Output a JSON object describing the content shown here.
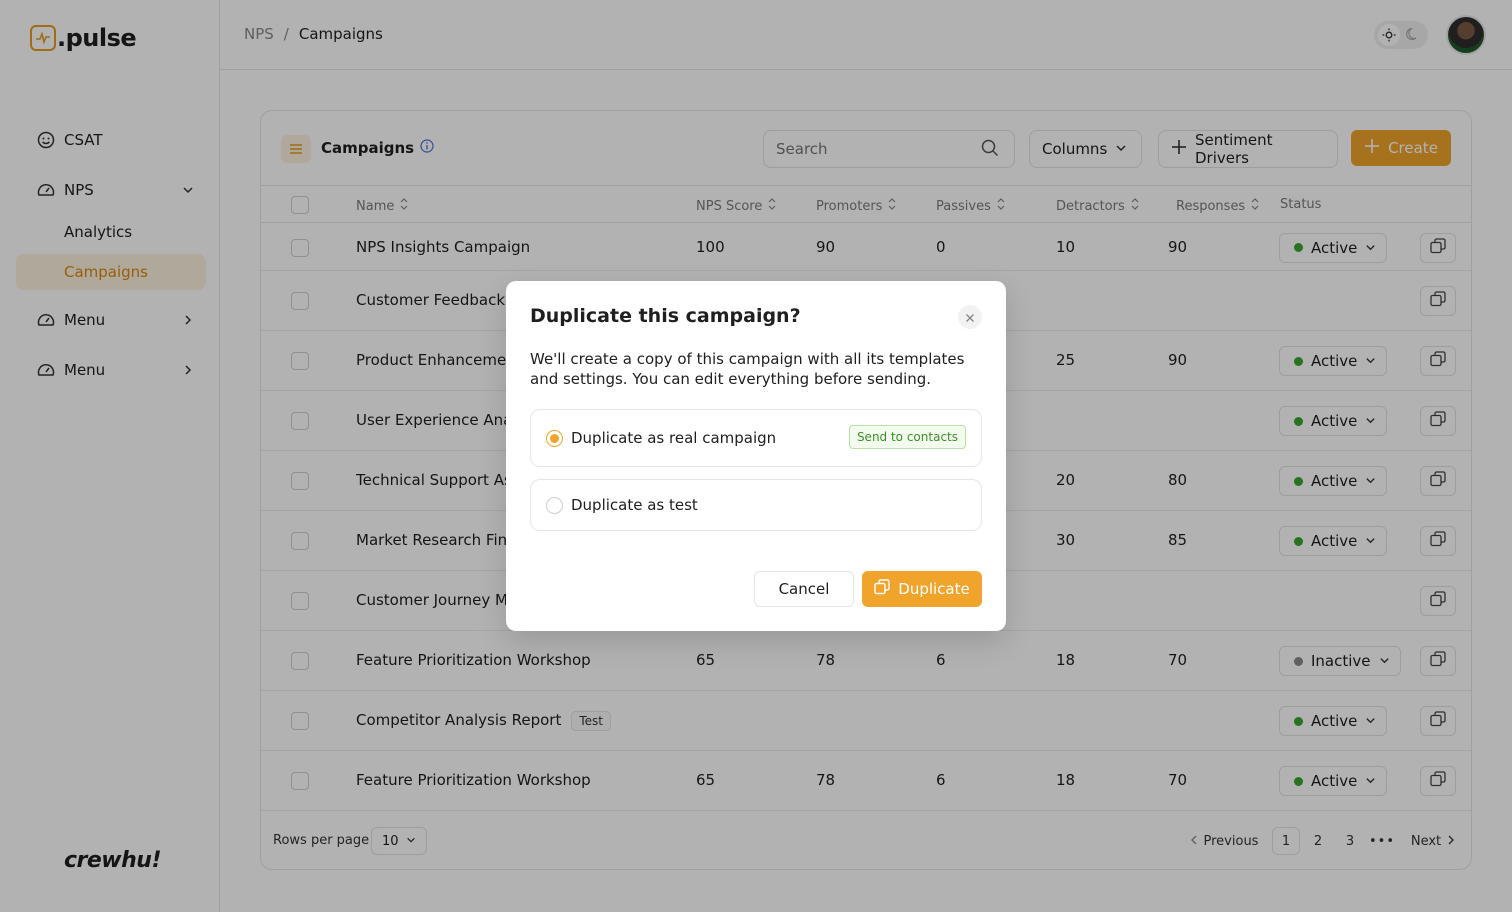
{
  "app": {
    "logo_text": ".pulse",
    "footer_brand": "crewhu!"
  },
  "sidebar": {
    "items": [
      {
        "label": "CSAT",
        "icon": "smile-icon"
      },
      {
        "label": "NPS",
        "icon": "gauge-icon"
      },
      {
        "label": "Analytics"
      },
      {
        "label": "Campaigns"
      },
      {
        "label": "Menu",
        "icon": "gauge-icon"
      },
      {
        "label": "Menu",
        "icon": "gauge-icon"
      }
    ]
  },
  "header": {
    "breadcrumb_root": "NPS",
    "breadcrumb_sep": "/",
    "breadcrumb_current": "Campaigns"
  },
  "toolbar": {
    "title": "Campaigns",
    "search_placeholder": "Search",
    "columns_label": "Columns",
    "drivers_label": "Sentiment Drivers",
    "create_label": "Create"
  },
  "table": {
    "columns": [
      "Name",
      "NPS Score",
      "Promoters",
      "Passives",
      "Detractors",
      "Responses",
      "Status"
    ],
    "rows": [
      {
        "name": "NPS Insights Campaign",
        "badge": "",
        "nps": "100",
        "promoters": "90",
        "passives": "0",
        "detractors": "10",
        "responses": "90",
        "status": "Active"
      },
      {
        "name": "Customer Feedback I",
        "badge": "",
        "nps": "",
        "promoters": "",
        "passives": "",
        "detractors": "",
        "responses": "",
        "status": ""
      },
      {
        "name": "Product Enhancemen",
        "badge": "",
        "nps": "",
        "promoters": "",
        "passives": "",
        "detractors": "25",
        "responses": "90",
        "status": "Active"
      },
      {
        "name": "User Experience Analy",
        "badge": "",
        "nps": "",
        "promoters": "",
        "passives": "",
        "detractors": "",
        "responses": "",
        "status": "Active"
      },
      {
        "name": "Technical Support As",
        "badge": "",
        "nps": "",
        "promoters": "",
        "passives": "",
        "detractors": "20",
        "responses": "80",
        "status": "Active"
      },
      {
        "name": "Market Research Find",
        "badge": "",
        "nps": "",
        "promoters": "",
        "passives": "",
        "detractors": "30",
        "responses": "85",
        "status": "Active"
      },
      {
        "name": "Customer Journey Ma",
        "badge": "",
        "nps": "",
        "promoters": "",
        "passives": "",
        "detractors": "",
        "responses": "",
        "status": ""
      },
      {
        "name": "Feature Prioritization Workshop",
        "badge": "",
        "nps": "65",
        "promoters": "78",
        "passives": "6",
        "detractors": "18",
        "responses": "70",
        "status": "Inactive"
      },
      {
        "name": "Competitor Analysis Report",
        "badge": "Test",
        "nps": "",
        "promoters": "",
        "passives": "",
        "detractors": "",
        "responses": "",
        "status": "Active"
      },
      {
        "name": "Feature Prioritization Workshop",
        "badge": "",
        "nps": "65",
        "promoters": "78",
        "passives": "6",
        "detractors": "18",
        "responses": "70",
        "status": "Active"
      }
    ]
  },
  "pagination": {
    "rows_per_page_label": "Rows per page",
    "rows_per_page_value": "10",
    "previous_label": "Previous",
    "pages": [
      "1",
      "2",
      "3"
    ],
    "ellipsis": "•••",
    "next_label": "Next"
  },
  "modal": {
    "title": "Duplicate this campaign?",
    "description": "We'll create a copy of this campaign with all its templates and settings. You can edit everything before sending.",
    "option_real": "Duplicate as real campaign",
    "option_real_badge": "Send to contacts",
    "option_test": "Duplicate as test",
    "cancel_label": "Cancel",
    "confirm_label": "Duplicate"
  },
  "colors": {
    "accent": "#f0a42c",
    "active": "#3aa52e",
    "inactive": "#8a8a8a"
  }
}
